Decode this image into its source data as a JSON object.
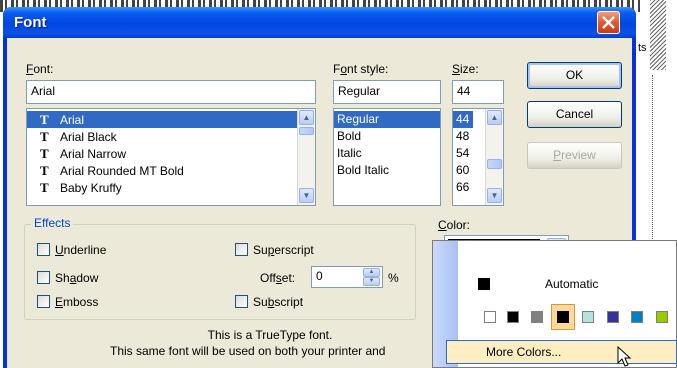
{
  "background": {
    "fragment_text": "ts"
  },
  "dialog": {
    "title": "Font",
    "font_label": "Font:",
    "font_value": "Arial",
    "fonts": [
      "Arial",
      "Arial Black",
      "Arial Narrow",
      "Arial Rounded MT Bold",
      "Baby Kruffy"
    ],
    "style_label": "Font style:",
    "style_value": "Regular",
    "styles": [
      "Regular",
      "Bold",
      "Italic",
      "Bold Italic"
    ],
    "size_label": "Size:",
    "size_value": "44",
    "sizes": [
      "44",
      "48",
      "54",
      "60",
      "66"
    ],
    "buttons": {
      "ok": "OK",
      "cancel": "Cancel",
      "preview": "Preview"
    },
    "effects": {
      "label": "Effects",
      "underline": "Underline",
      "shadow": "Shadow",
      "emboss": "Emboss",
      "superscript": "Superscript",
      "offset_label": "Offset:",
      "offset_value": "0",
      "offset_unit": "%",
      "subscript": "Subscript"
    },
    "color_label": "Color:",
    "info_line1": "This is a TrueType font.",
    "info_line2": "This same font will be used on both your printer and"
  },
  "color_dropdown": {
    "automatic": "Automatic",
    "more_colors": "More Colors...",
    "swatches": [
      "#ffffff",
      "#000000",
      "#808080",
      "#000000",
      "#b8e0dc",
      "#333399",
      "#0080c0",
      "#008080",
      "#99cc00"
    ],
    "selected_color": "#000000"
  }
}
